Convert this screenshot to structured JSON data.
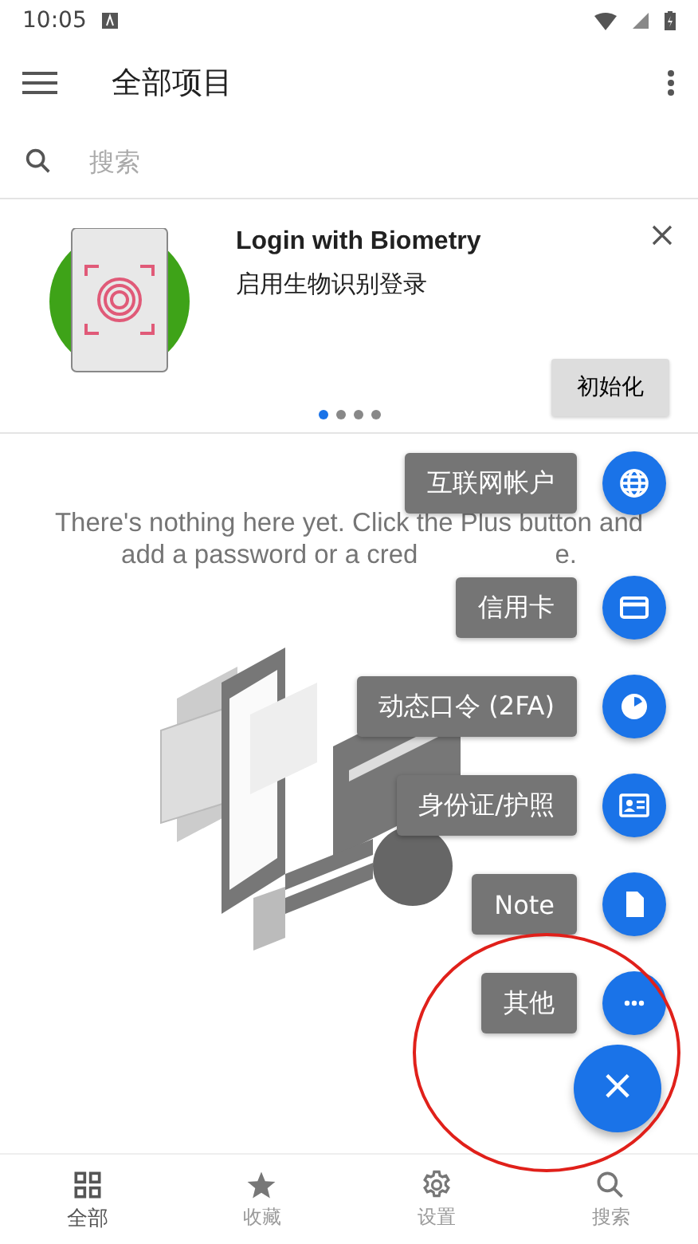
{
  "status_bar": {
    "time": "10:05"
  },
  "toolbar": {
    "title": "全部项目"
  },
  "search": {
    "placeholder": "搜索"
  },
  "promo": {
    "title": "Login with Biometry",
    "subtitle": "启用生物识别登录",
    "button": "初始化",
    "pages": [
      {
        "selected": true
      },
      {
        "selected": false
      },
      {
        "selected": false
      },
      {
        "selected": false
      }
    ]
  },
  "empty_message": {
    "line_1": "There's nothing here yet. Click the Plus button and",
    "line_2_start": "add a password or a cred",
    "line_2_end": "e."
  },
  "speed_dial": [
    {
      "kind": "globe",
      "label": "互联网帐户"
    },
    {
      "kind": "card",
      "label": "信用卡"
    },
    {
      "kind": "timer",
      "label": "动态口令 (2FA)"
    },
    {
      "kind": "id",
      "label": "身份证/护照"
    },
    {
      "kind": "note",
      "label": "Note"
    },
    {
      "kind": "more",
      "label": "其他"
    }
  ],
  "fab": {
    "symbol": "×"
  },
  "bottom_nav": [
    {
      "kind": "grid",
      "label": "全部",
      "selected": true
    },
    {
      "kind": "star",
      "label": "收藏",
      "selected": false
    },
    {
      "kind": "gear",
      "label": "设置",
      "selected": false
    },
    {
      "kind": "search",
      "label": "搜索",
      "selected": false
    }
  ]
}
